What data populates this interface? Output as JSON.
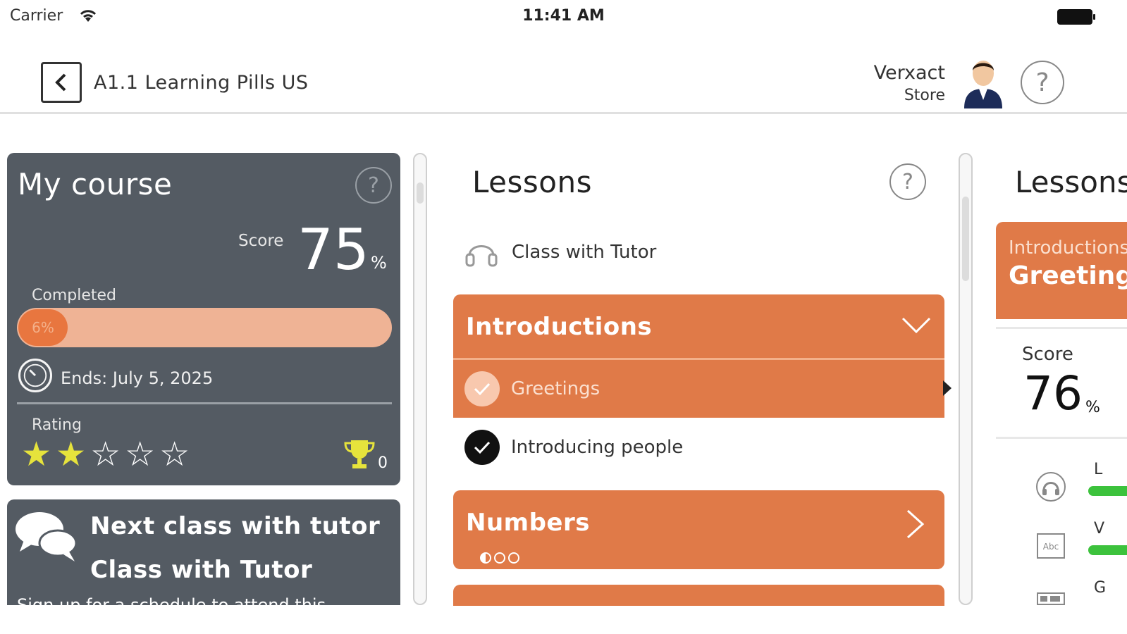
{
  "status_bar": {
    "carrier": "Carrier",
    "time": "11:41 AM"
  },
  "header": {
    "title": "A1.1 Learning Pills US",
    "store_name": "Verxact",
    "store_sub": "Store",
    "help_symbol": "?"
  },
  "course": {
    "title": "My course",
    "help_symbol": "?",
    "score_label": "Score",
    "score_value": "75",
    "score_unit": "%",
    "completed_label": "Completed",
    "completed_text": "6%",
    "completed_fraction": 0.06,
    "ends_text": "Ends: July 5, 2025",
    "rating_label": "Rating",
    "rating_value": 2,
    "rating_max": 5,
    "trophy_count": "0"
  },
  "next_class": {
    "title": "Next class with tutor",
    "subtitle": "Class with Tutor",
    "description": "Sign up for a schedule to attend this"
  },
  "lessons": {
    "title": "Lessons",
    "help_symbol": "?",
    "tutor_label": "Class with Tutor",
    "sections": [
      {
        "title": "Introductions",
        "expanded": true,
        "items": [
          {
            "label": "Greetings",
            "active": true
          },
          {
            "label": "Introducing people",
            "active": false
          }
        ]
      },
      {
        "title": "Numbers",
        "expanded": false
      }
    ]
  },
  "lesson_detail": {
    "title": "Lessons",
    "banner_sub": "Introductions",
    "banner_title": "Greetings",
    "score_label": "Score",
    "score_value": "76",
    "score_unit": "%",
    "skills": [
      {
        "icon": "headphones-icon",
        "letter": "L",
        "color": "#3cc23c"
      },
      {
        "icon": "vocabulary-icon",
        "letter": "V",
        "color": "#3cc23c"
      },
      {
        "icon": "grammar-icon",
        "letter": "G",
        "color": "#3cc23c"
      }
    ]
  },
  "colors": {
    "card_bg": "#545b63",
    "accent_orange": "#e07a48",
    "progress_track": "#efb395",
    "star_on": "#e6e33c",
    "trophy": "#e6e33c",
    "skill_green": "#3cc23c"
  }
}
